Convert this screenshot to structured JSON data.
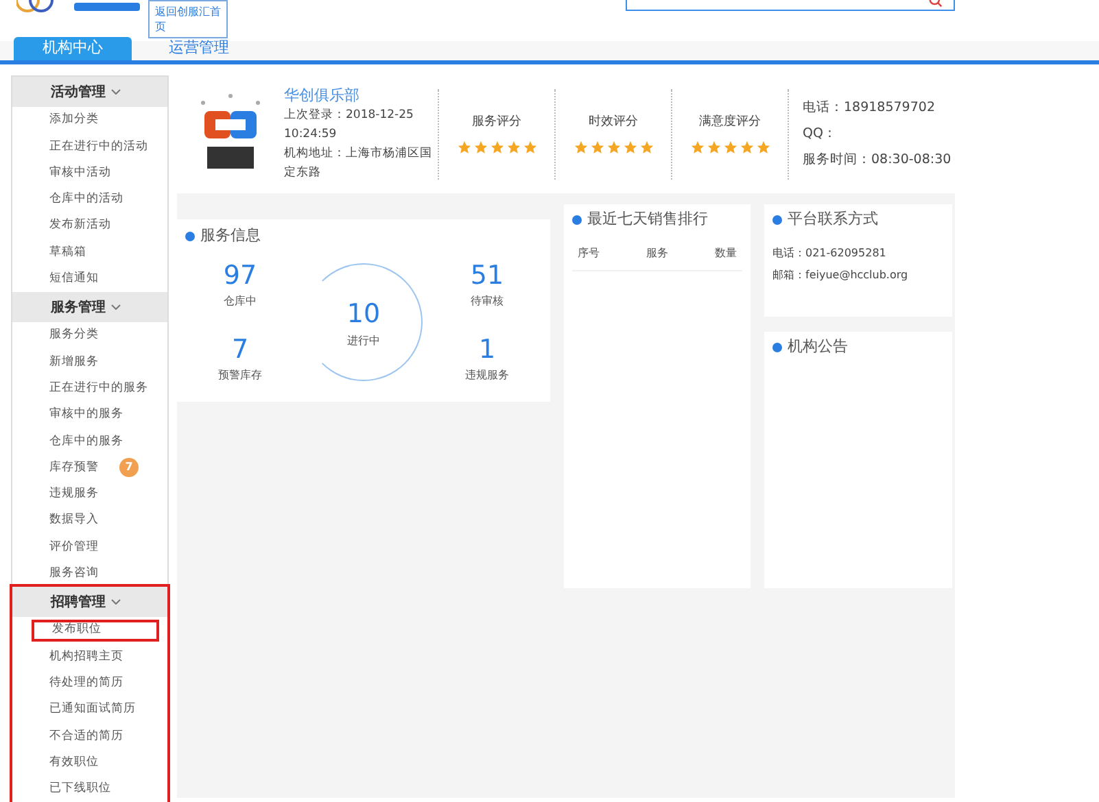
{
  "header": {
    "back_link": "返回创服汇首页"
  },
  "tabs": [
    {
      "label": "机构中心",
      "selected": true
    },
    {
      "label": "运营管理",
      "selected": false
    }
  ],
  "sidebar": {
    "groups": [
      {
        "title": "活动管理",
        "highlighted": false,
        "items": [
          {
            "label": "添加分类",
            "highlighted": false
          },
          {
            "label": "正在进行中的活动",
            "highlighted": false
          },
          {
            "label": "审核中活动",
            "highlighted": false
          },
          {
            "label": "仓库中的活动",
            "highlighted": false
          },
          {
            "label": "发布新活动",
            "highlighted": false
          },
          {
            "label": "草稿箱",
            "highlighted": false
          },
          {
            "label": "短信通知",
            "highlighted": false
          }
        ]
      },
      {
        "title": "服务管理",
        "highlighted": false,
        "items": [
          {
            "label": "服务分类",
            "highlighted": false
          },
          {
            "label": "新增服务",
            "highlighted": false
          },
          {
            "label": "正在进行中的服务",
            "highlighted": false
          },
          {
            "label": "审核中的服务",
            "highlighted": false
          },
          {
            "label": "仓库中的服务",
            "highlighted": false
          },
          {
            "label": "库存预警",
            "highlighted": false,
            "badge": "7"
          },
          {
            "label": "违规服务",
            "highlighted": false
          },
          {
            "label": "数据导入",
            "highlighted": false
          },
          {
            "label": "评价管理",
            "highlighted": false
          },
          {
            "label": "服务咨询",
            "highlighted": false
          }
        ]
      },
      {
        "title": "招聘管理",
        "highlighted": true,
        "items": [
          {
            "label": "发布职位",
            "highlighted": true
          },
          {
            "label": "机构招聘主页",
            "highlighted": false
          },
          {
            "label": "待处理的简历",
            "highlighted": false
          },
          {
            "label": "已通知面试简历",
            "highlighted": false
          },
          {
            "label": "不合适的简历",
            "highlighted": false
          },
          {
            "label": "有效职位",
            "highlighted": false
          },
          {
            "label": "已下线职位",
            "highlighted": false
          }
        ]
      }
    ]
  },
  "profile": {
    "name": "华创俱乐部",
    "last_login": "上次登录：2018-12-25 10:24:59",
    "address": "机构地址：上海市杨浦区国定东路",
    "ratings": [
      {
        "label": "服务评分",
        "stars": 5
      },
      {
        "label": "时效评分",
        "stars": 5
      },
      {
        "label": "满意度评分",
        "stars": 5
      }
    ],
    "contact": [
      "电话：18918579702",
      "QQ：",
      "服务时间：08:30-08:30"
    ]
  },
  "service_info": {
    "title": "服务信息",
    "stats": [
      {
        "value": "97",
        "label": "仓库中"
      },
      {
        "value": "51",
        "label": "待审核"
      },
      {
        "value": "7",
        "label": "预警库存"
      },
      {
        "value": "1",
        "label": "违规服务"
      }
    ],
    "center": {
      "value": "10",
      "label": "进行中"
    }
  },
  "sales_ranking": {
    "title": "最近七天销售排行",
    "columns": [
      "序号",
      "服务",
      "数量"
    ]
  },
  "platform_contact": {
    "title": "平台联系方式",
    "lines": [
      "电话：021-62095281",
      "邮箱：feiyue@hcclub.org"
    ]
  },
  "notice": {
    "title": "机构公告"
  }
}
